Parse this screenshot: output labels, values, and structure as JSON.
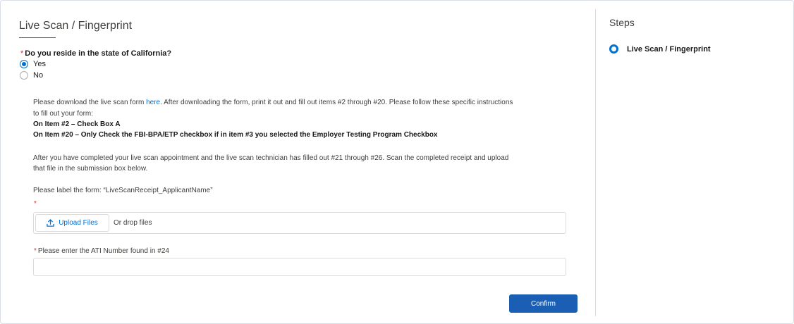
{
  "form": {
    "title": "Live Scan / Fingerprint",
    "question": {
      "required_mark": "*",
      "label": "Do you reside in the state of California?",
      "options": [
        {
          "label": "Yes",
          "selected": true
        },
        {
          "label": "No",
          "selected": false
        }
      ]
    },
    "instructions": {
      "line1_prefix": "Please download the live scan form ",
      "link_text": "here",
      "line1_suffix": ". After downloading the form, print it out and fill out items #2 through #20. Please follow these specific instructions",
      "line2": "to fill out your form:",
      "item2": "On Item #2 – Check Box A",
      "item20": "On Item #20 – Only Check the FBI-BPA/ETP checkbox if in item #3 you selected the Employer Testing Program Checkbox",
      "after_line1": "After you have completed your live scan appointment and the live scan technician has filled out #21 through #26. Scan the completed receipt and upload",
      "after_line2": "that file in the submission box below.",
      "label_line": "Please label the form: “LiveScanReceipt_ApplicantName”"
    },
    "upload": {
      "required_mark": "*",
      "button_label": "Upload Files",
      "drop_text": "Or drop files"
    },
    "ati": {
      "required_mark": "*",
      "label": "Please enter the ATI Number found in #24",
      "value": "",
      "placeholder": ""
    },
    "confirm_label": "Confirm"
  },
  "steps": {
    "title": "Steps",
    "items": [
      {
        "label": "Live Scan / Fingerprint",
        "active": true
      }
    ]
  },
  "colors": {
    "accent": "#0070d2",
    "button": "#1b5fb4",
    "required": "#c23934"
  }
}
